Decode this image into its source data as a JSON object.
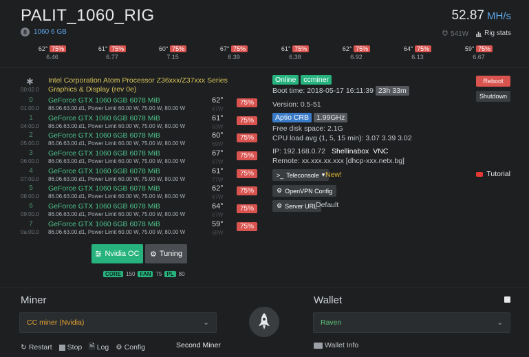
{
  "rig": {
    "name": "PALIT_1060_RIG",
    "gpu_count": "8",
    "gpu_model": "1060 6 GB",
    "hashrate": "52.87",
    "hashrate_unit": "MH/s",
    "power": "541W",
    "rig_stats_label": "Rig stats"
  },
  "top_gpus": [
    {
      "temp": "62°",
      "fan": "75%",
      "hashrate": "6.46"
    },
    {
      "temp": "61°",
      "fan": "75%",
      "hashrate": "6.77"
    },
    {
      "temp": "60°",
      "fan": "75%",
      "hashrate": "7.15"
    },
    {
      "temp": "67°",
      "fan": "75%",
      "hashrate": "6.39"
    },
    {
      "temp": "61°",
      "fan": "75%",
      "hashrate": "6.38"
    },
    {
      "temp": "62°",
      "fan": "75%",
      "hashrate": "6.92"
    },
    {
      "temp": "64°",
      "fan": "75%",
      "hashrate": "6.13"
    },
    {
      "temp": "59°",
      "fan": "75%",
      "hashrate": "6.67"
    }
  ],
  "cpu": {
    "time": "00:02.0",
    "name": "Intel Corporation Atom Processor Z36xxx/Z37xxx Series Graphics & Display (rev 0e)"
  },
  "gpus": [
    {
      "index": "0",
      "time": "01:00.0",
      "name": "GeForce GTX 1060 6GB 6078 MiB",
      "desc": "86.06.63.00.d1, Power Limit 60.00 W, 75.00 W, 80.00 W",
      "temp": "62°",
      "watt": "67W",
      "fan": "75%"
    },
    {
      "index": "1",
      "time": "04:00.0",
      "name": "GeForce GTX 1060 6GB 6078 MiB",
      "desc": "86.06.63.00.d1, Power Limit 60.00 W, 75.00 W, 80.00 W",
      "temp": "61°",
      "watt": "63W",
      "fan": "75%"
    },
    {
      "index": "2",
      "time": "05:00.0",
      "name": "GeForce GTX 1060 6GB 6078 MiB",
      "desc": "86.06.63.00.d1, Power Limit 60.00 W, 75.00 W, 80.00 W",
      "temp": "60°",
      "watt": "69W",
      "fan": "75%"
    },
    {
      "index": "3",
      "time": "06:00.0",
      "name": "GeForce GTX 1060 6GB 6078 MiB",
      "desc": "86.06.63.00.d1, Power Limit 60.00 W, 75.00 W, 80.00 W",
      "temp": "67°",
      "watt": "67W",
      "fan": "75%"
    },
    {
      "index": "4",
      "time": "07:00.0",
      "name": "GeForce GTX 1060 6GB 6078 MiB",
      "desc": "86.06.63.00.d1, Power Limit 60.00 W, 75.00 W, 80.00 W",
      "temp": "61°",
      "watt": "77W",
      "fan": "75%"
    },
    {
      "index": "5",
      "time": "08:00.0",
      "name": "GeForce GTX 1060 6GB 6078 MiB",
      "desc": "86.06.63.00.d1, Power Limit 60.00 W, 75.00 W, 80.00 W",
      "temp": "62°",
      "watt": "67W",
      "fan": "75%"
    },
    {
      "index": "6",
      "time": "09:00.0",
      "name": "GeForce GTX 1060 6GB 6078 MiB",
      "desc": "86.06.63.00.d1, Power Limit 60.00 W, 75.00 W, 80.00 W",
      "temp": "64°",
      "watt": "67W",
      "fan": "75%"
    },
    {
      "index": "7",
      "time": "0a:00.0",
      "name": "GeForce GTX 1060 6GB 6078 MiB",
      "desc": "86.06.63.00.d1, Power Limit 60.00 W, 75.00 W, 80.00 W",
      "temp": "59°",
      "watt": "68W",
      "fan": "75%"
    }
  ],
  "oc": {
    "nvidia_oc_label": "Nvidia OC",
    "tuning_label": "Tuning",
    "core_label": "CORE",
    "core_value": "150",
    "fan_label": "FAN",
    "fan_value": "75",
    "pl_label": "PL",
    "pl_value": "80"
  },
  "status": {
    "online": "Online",
    "miner": "ccminer",
    "boot_time_label": "Boot time: 2018-05-17 16:11:39",
    "uptime": "23h 33m",
    "version": "Version: 0.5-51",
    "cpu_tag": "Aptio CRB",
    "cpu_freq": "1.99GHz",
    "disk": "Free disk space: 2.1G",
    "load": "CPU load avg (1, 5, 15 min): 3.07 3.39 3.02",
    "ip": "IP: 192.168.0.72",
    "shellinabox": "Shellinabox",
    "vnc": "VNC",
    "remote": "Remote: xx.xxx.xx.xxx [dhcp-xxx.netx.bg]",
    "teleconsole": "Teleconsole",
    "new": "New!",
    "openvpn": "OpenVPN Config",
    "server_url": "Server URL",
    "server_url_value": "Default"
  },
  "actions": {
    "reboot": "Reboot",
    "shutdown": "Shutdown",
    "tutorial": "Tutorial"
  },
  "miner": {
    "title": "Miner",
    "selected": "CC miner (Nvidia)",
    "restart": "Restart",
    "stop": "Stop",
    "log": "Log",
    "config": "Config",
    "second_miner": "Second Miner"
  },
  "wallet": {
    "title": "Wallet",
    "selected": "Raven",
    "info": "Wallet Info"
  },
  "colors": {
    "accent_green": "#27b37e",
    "accent_red": "#d9534f",
    "accent_blue": "#3a7bc8",
    "gpu_name_green": "#4fc48a",
    "cpu_yellow": "#d8c45a",
    "miner_orange": "#e0a030",
    "wallet_green": "#5fc37a"
  }
}
